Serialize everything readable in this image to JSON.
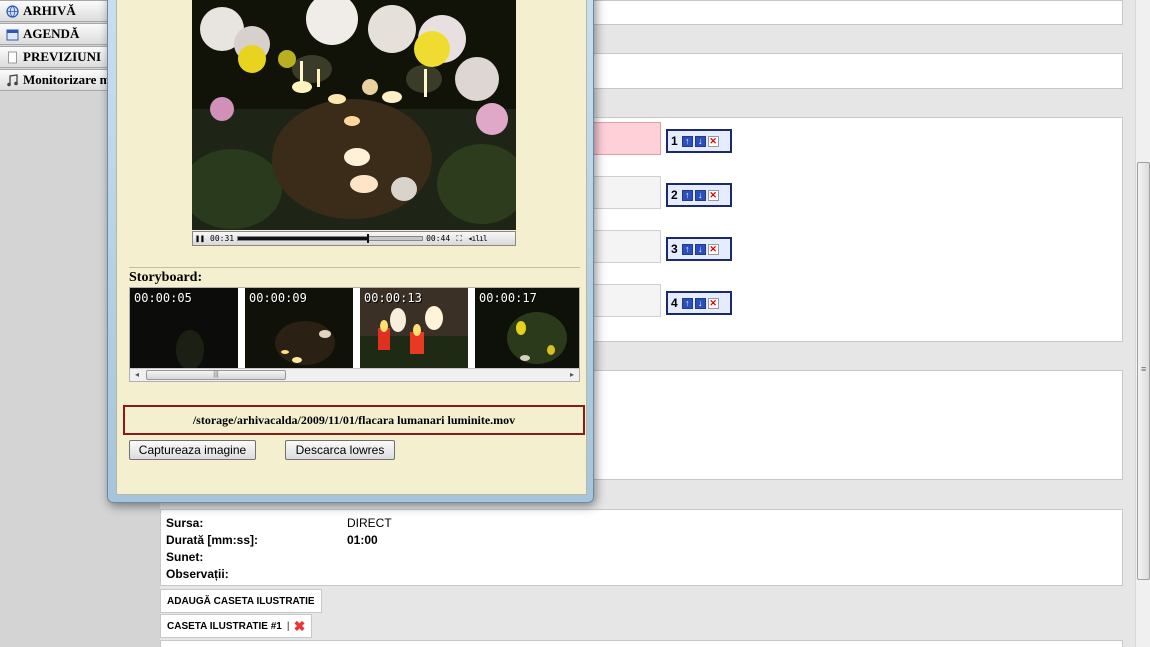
{
  "sidebar": {
    "items": [
      {
        "label": "ARHIVĂ",
        "icon": "globe-icon"
      },
      {
        "label": "AGENDĂ",
        "icon": "calendar-icon"
      },
      {
        "label": "PREVIZIUNI",
        "icon": "document-icon"
      },
      {
        "label": "Monitorizare m",
        "icon": "music-note-icon"
      }
    ]
  },
  "media_list": {
    "items": [
      {
        "index": "1",
        "highlighted": true
      },
      {
        "index": "2",
        "highlighted": false
      },
      {
        "index": "3",
        "highlighted": false
      },
      {
        "index": "4",
        "highlighted": false
      }
    ]
  },
  "metadata": {
    "rows": [
      {
        "key": "Sursa:",
        "value": "DIRECT"
      },
      {
        "key": "Durată [mm:ss]:",
        "value": "01:00"
      },
      {
        "key": "Sunet:",
        "value": ""
      },
      {
        "key": "Observații:",
        "value": ""
      }
    ]
  },
  "tabs": {
    "add_label": "ADAUGĂ CASETA ILUSTRATIE",
    "current_label": "CASETA ILUSTRATIE #1"
  },
  "player": {
    "current_time": "00:31",
    "total_time": "00:44",
    "progress": 0.705
  },
  "storyboard": {
    "title": "Storyboard:",
    "frames": [
      "00:00:05",
      "00:00:09",
      "00:00:13",
      "00:00:17"
    ]
  },
  "file_path": "/storage/arhivacalda/2009/11/01/flacara lumanari luminite.mov",
  "buttons": {
    "capture": "Captureaza imagine",
    "download": "Descarca lowres"
  },
  "colors": {
    "highlight_pink": "#ffd0d8",
    "control_border": "#1a2a6a",
    "path_border": "#8a1a1a",
    "popup_bg": "#f4efcf"
  }
}
